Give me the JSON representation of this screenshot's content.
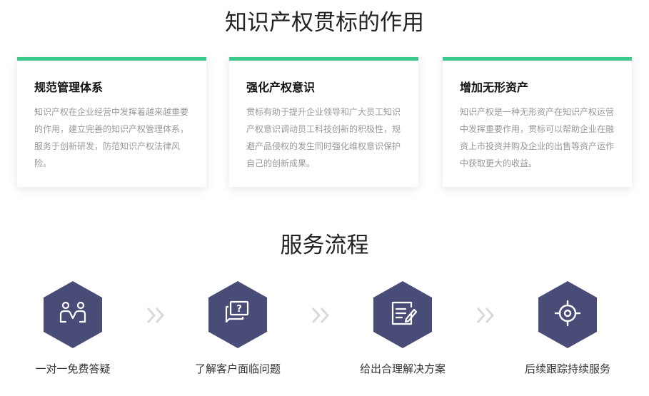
{
  "section1": {
    "title": "知识产权贯标的作用",
    "cards": [
      {
        "title": "规范管理体系",
        "text": "知识产权在企业经营中发挥着越来越重要的作用，建立完善的知识产权管理体系，服务于创新研发，防范知识产权法律风险。"
      },
      {
        "title": "强化产权意识",
        "text": "贯标有助于提升企业领导和广大员工知识产权意识调动员工科技创新的积极性，规避产品侵权的发生同时强化维权意识保护自己的创新成果。"
      },
      {
        "title": "增加无形资产",
        "text": "知识产权是一种无形资产在知识产权运营中发挥重要作用，贯标可以帮助企业在融资上市投资并购及企业的出售等资产运作中获取更大的收益。"
      }
    ]
  },
  "section2": {
    "title": "服务流程",
    "steps": [
      {
        "label": "一对一免费答疑",
        "icon": "people-icon"
      },
      {
        "label": "了解客户面临问题",
        "icon": "question-chat-icon"
      },
      {
        "label": "给出合理解决方案",
        "icon": "document-edit-icon"
      },
      {
        "label": "后续跟踪持续服务",
        "icon": "target-icon"
      }
    ]
  },
  "colors": {
    "accent_green": "#3dc98c",
    "hex_fill": "#4a4c78",
    "arrow": "#d8d9e0"
  }
}
